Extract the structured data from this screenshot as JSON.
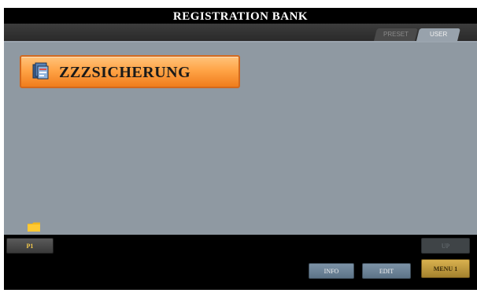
{
  "header": {
    "title": "REGISTRATION BANK"
  },
  "tabs": [
    {
      "label": "PRESET",
      "active": false
    },
    {
      "label": "USER",
      "active": true
    }
  ],
  "bank_list": {
    "items": [
      {
        "label": "ZZZSICHERUNG",
        "selected": true,
        "icon": "registration-bank-icon"
      }
    ],
    "folder_icon": "folder-icon"
  },
  "buttons": {
    "page_label": "P1",
    "up_label": "UP",
    "info_label": "INFO",
    "edit_label": "EDIT",
    "menu_label": "MENU 1"
  },
  "colors": {
    "selected_item": "#ffa447",
    "content_bg": "#8f99a2",
    "menu_button": "#d9b14f"
  }
}
